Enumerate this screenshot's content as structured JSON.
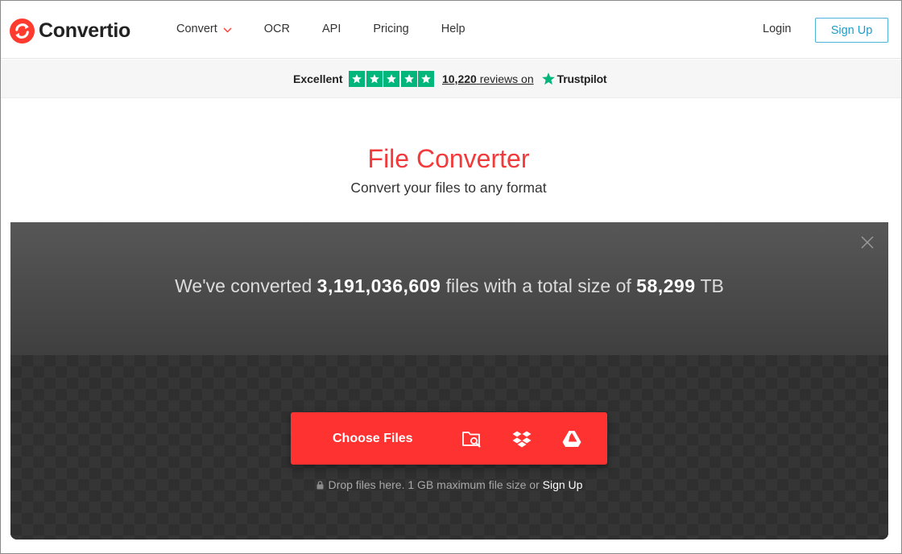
{
  "brand": {
    "name": "Convertio",
    "accent": "#ff3232",
    "title_color": "#f33a3a"
  },
  "nav": {
    "items": [
      {
        "label": "Convert",
        "has_dropdown": true
      },
      {
        "label": "OCR"
      },
      {
        "label": "API"
      },
      {
        "label": "Pricing"
      },
      {
        "label": "Help"
      }
    ],
    "login": "Login",
    "signup": "Sign Up"
  },
  "trust": {
    "rating_word": "Excellent",
    "stars": 5,
    "review_count": "10,220",
    "review_suffix": "reviews on",
    "provider": "Trustpilot",
    "star_color": "#00b67a"
  },
  "hero": {
    "title": "File Converter",
    "subtitle": "Convert your files to any format"
  },
  "stats": {
    "prefix": "We've converted",
    "files_count": "3,191,036,609",
    "middle": "files with a total size of",
    "total_size": "58,299",
    "unit": "TB"
  },
  "upload": {
    "choose_label": "Choose Files",
    "sources": [
      "folder-search-icon",
      "dropbox-icon",
      "google-drive-icon"
    ],
    "hint_prefix": "Drop files here. 1 GB maximum file size or",
    "hint_link": "Sign Up"
  }
}
